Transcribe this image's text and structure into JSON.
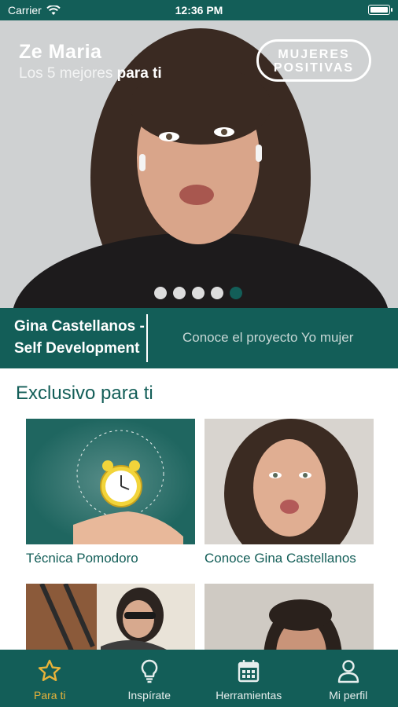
{
  "status_bar": {
    "carrier": "Carrier",
    "time": "12:36 PM"
  },
  "hero": {
    "name": "Ze Maria",
    "subtitle_light": "Los 5 mejores",
    "subtitle_bold": "para ti",
    "brand_line1": "MUJERES",
    "brand_line2": "POSITIVAS",
    "slide_count": 5,
    "active_slide": 5
  },
  "band": {
    "title": "Gina Castellanos - Self Development",
    "link": "Conoce el proyecto Yo mujer"
  },
  "section": {
    "title": "Exclusivo para ti",
    "cards": [
      {
        "label": "Técnica Pomodoro"
      },
      {
        "label": "Conoce Gina Castellanos"
      },
      {
        "label": ""
      },
      {
        "label": ""
      }
    ]
  },
  "nav": {
    "items": [
      {
        "label": "Para ti",
        "icon": "star-icon",
        "active": true
      },
      {
        "label": "Inspírate",
        "icon": "lightbulb-icon",
        "active": false
      },
      {
        "label": "Herramientas",
        "icon": "calendar-icon",
        "active": false
      },
      {
        "label": "Mi perfil",
        "icon": "person-icon",
        "active": false
      }
    ]
  },
  "colors": {
    "brand": "#135e58",
    "active_nav": "#e8b33a"
  }
}
